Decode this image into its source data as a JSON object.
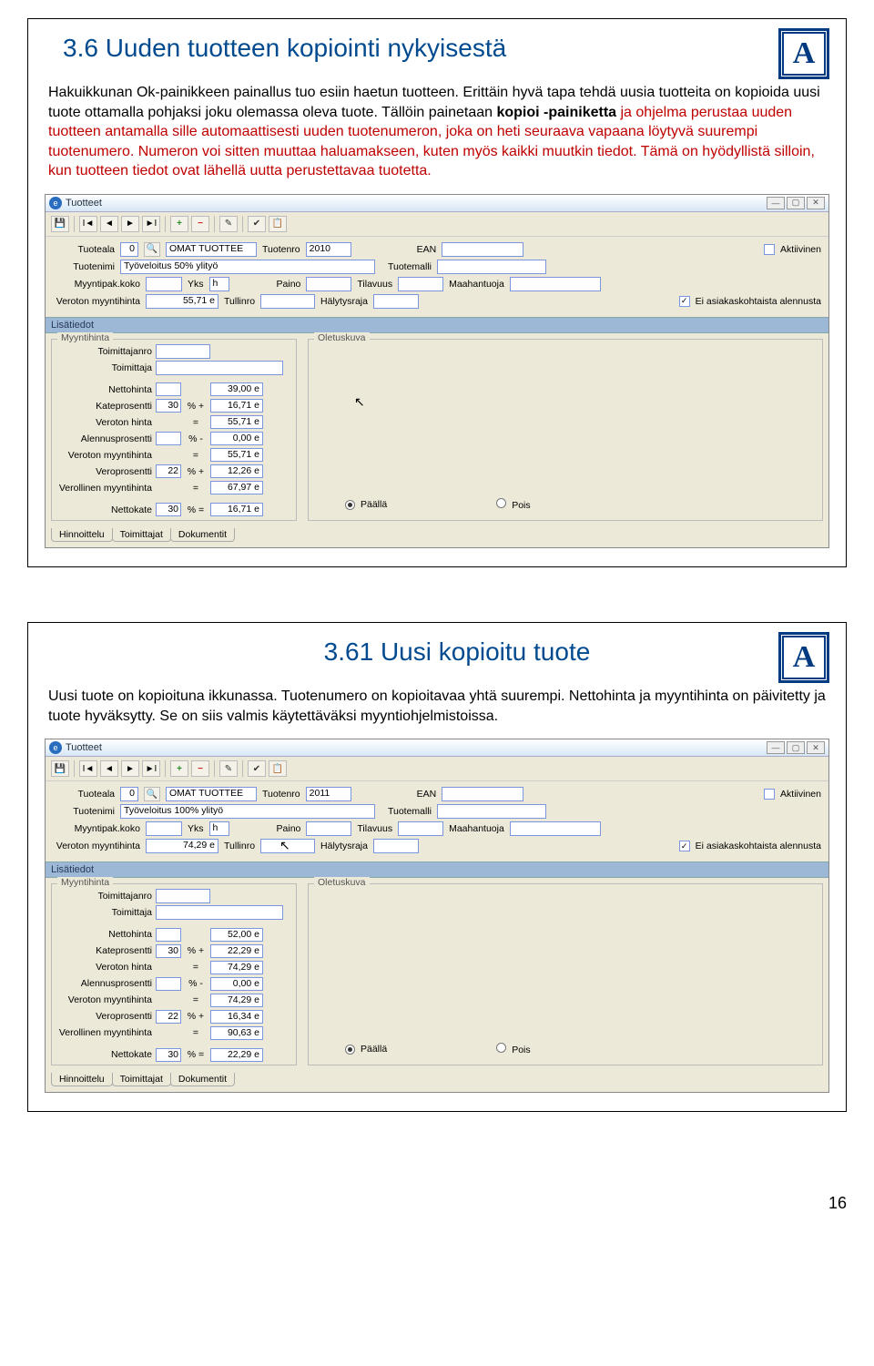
{
  "page_number": "16",
  "logo_letter": "A",
  "slide1": {
    "title": "3.6 Uuden tuotteen kopiointi nykyisestä",
    "para1": "Hakuikkunan Ok-painikkeen painallus tuo esiin haetun tuotteen. Erittäin hyvä tapa tehdä uusia tuotteita on kopioida uusi tuote ottamalla pohjaksi joku olemassa oleva tuote. Tällöin painetaan ",
    "para1_bold": "kopioi -painiketta",
    "para1_cont": " ja ohjelma perustaa uuden tuotteen antamalla sille automaattisesti uuden tuotenumeron, joka on heti seuraava vapaana löytyvä suurempi tuotenumero. Numeron voi sitten muuttaa haluamakseen, kuten myös kaikki muutkin tiedot. Tämä on hyödyllistä silloin, kun tuotteen tiedot ovat lähellä uutta perustettavaa tuotetta."
  },
  "slide2": {
    "title": "3.61 Uusi kopioitu tuote",
    "para": "Uusi tuote on kopioituna ikkunassa. Tuotenumero on kopioitavaa yhtä suurempi. Nettohinta ja myyntihinta on päivitetty ja tuote hyväksytty. Se on siis valmis käytettäväksi myyntiohjelmistoissa."
  },
  "window": {
    "title": "Tuotteet",
    "section_header": "Lisätiedot",
    "labels": {
      "tuoteala": "Tuoteala",
      "tuotenro": "Tuotenro",
      "ean": "EAN",
      "aktiivinen": "Aktiivinen",
      "tuotenimi": "Tuotenimi",
      "tuotemalli": "Tuotemalli",
      "myyntipak": "Myyntipak.koko",
      "yks": "Yks",
      "paino": "Paino",
      "tilavuus": "Tilavuus",
      "maahantuoja": "Maahantuoja",
      "veroton_myynti": "Veroton myyntihinta",
      "tullinro": "Tullinro",
      "halytysraja": "Hälytysraja",
      "ei_alennus": "Ei asiakaskohtaista alennusta",
      "myyntihinta_legend": "Myyntihinta",
      "oletuskuva_legend": "Oletuskuva",
      "toimittajanro": "Toimittajanro",
      "toimittaja": "Toimittaja",
      "nettohinta": "Nettohinta",
      "kateprosentti": "Kateprosentti",
      "veroton_hinta": "Veroton hinta",
      "alennusprosentti": "Alennusprosentti",
      "veroton_myyntihinta": "Veroton myyntihinta",
      "veroprosentti": "Veroprosentti",
      "verollinen_myyntihinta": "Verollinen myyntihinta",
      "nettokate": "Nettokate",
      "paalla": "Päällä",
      "pois": "Pois"
    },
    "tabs": {
      "hinnoittelu": "Hinnoittelu",
      "toimittajat": "Toimittajat",
      "dokumentit": "Dokumentit"
    }
  },
  "form1": {
    "tuoteala": "0",
    "tuoteala_name": "OMAT TUOTTEE",
    "tuotenro": "2010",
    "tuotenimi": "Työveloitus 50% ylityö",
    "yks": "h",
    "veroton_myynti": "55,71 e",
    "pricing": {
      "nettohinta": "39,00 e",
      "kate_pct": "30",
      "kate_val": "16,71 e",
      "veroton_hinta": "55,71 e",
      "alen_pct": "",
      "alen_val": "0,00 e",
      "veroton_myynti": "55,71 e",
      "vero_pct": "22",
      "vero_val": "12,26 e",
      "verollinen": "67,97 e",
      "nettokate_pct": "30",
      "nettokate_val": "16,71 e"
    }
  },
  "form2": {
    "tuoteala": "0",
    "tuoteala_name": "OMAT TUOTTEE",
    "tuotenro": "2011",
    "tuotenimi": "Työveloitus 100% ylityö",
    "yks": "h",
    "veroton_myynti": "74,29 e",
    "pricing": {
      "nettohinta": "52,00 e",
      "kate_pct": "30",
      "kate_val": "22,29 e",
      "veroton_hinta": "74,29 e",
      "alen_pct": "",
      "alen_val": "0,00 e",
      "veroton_myynti": "74,29 e",
      "vero_pct": "22",
      "vero_val": "16,34 e",
      "verollinen": "90,63 e",
      "nettokate_pct": "30",
      "nettokate_val": "22,29 e"
    }
  }
}
